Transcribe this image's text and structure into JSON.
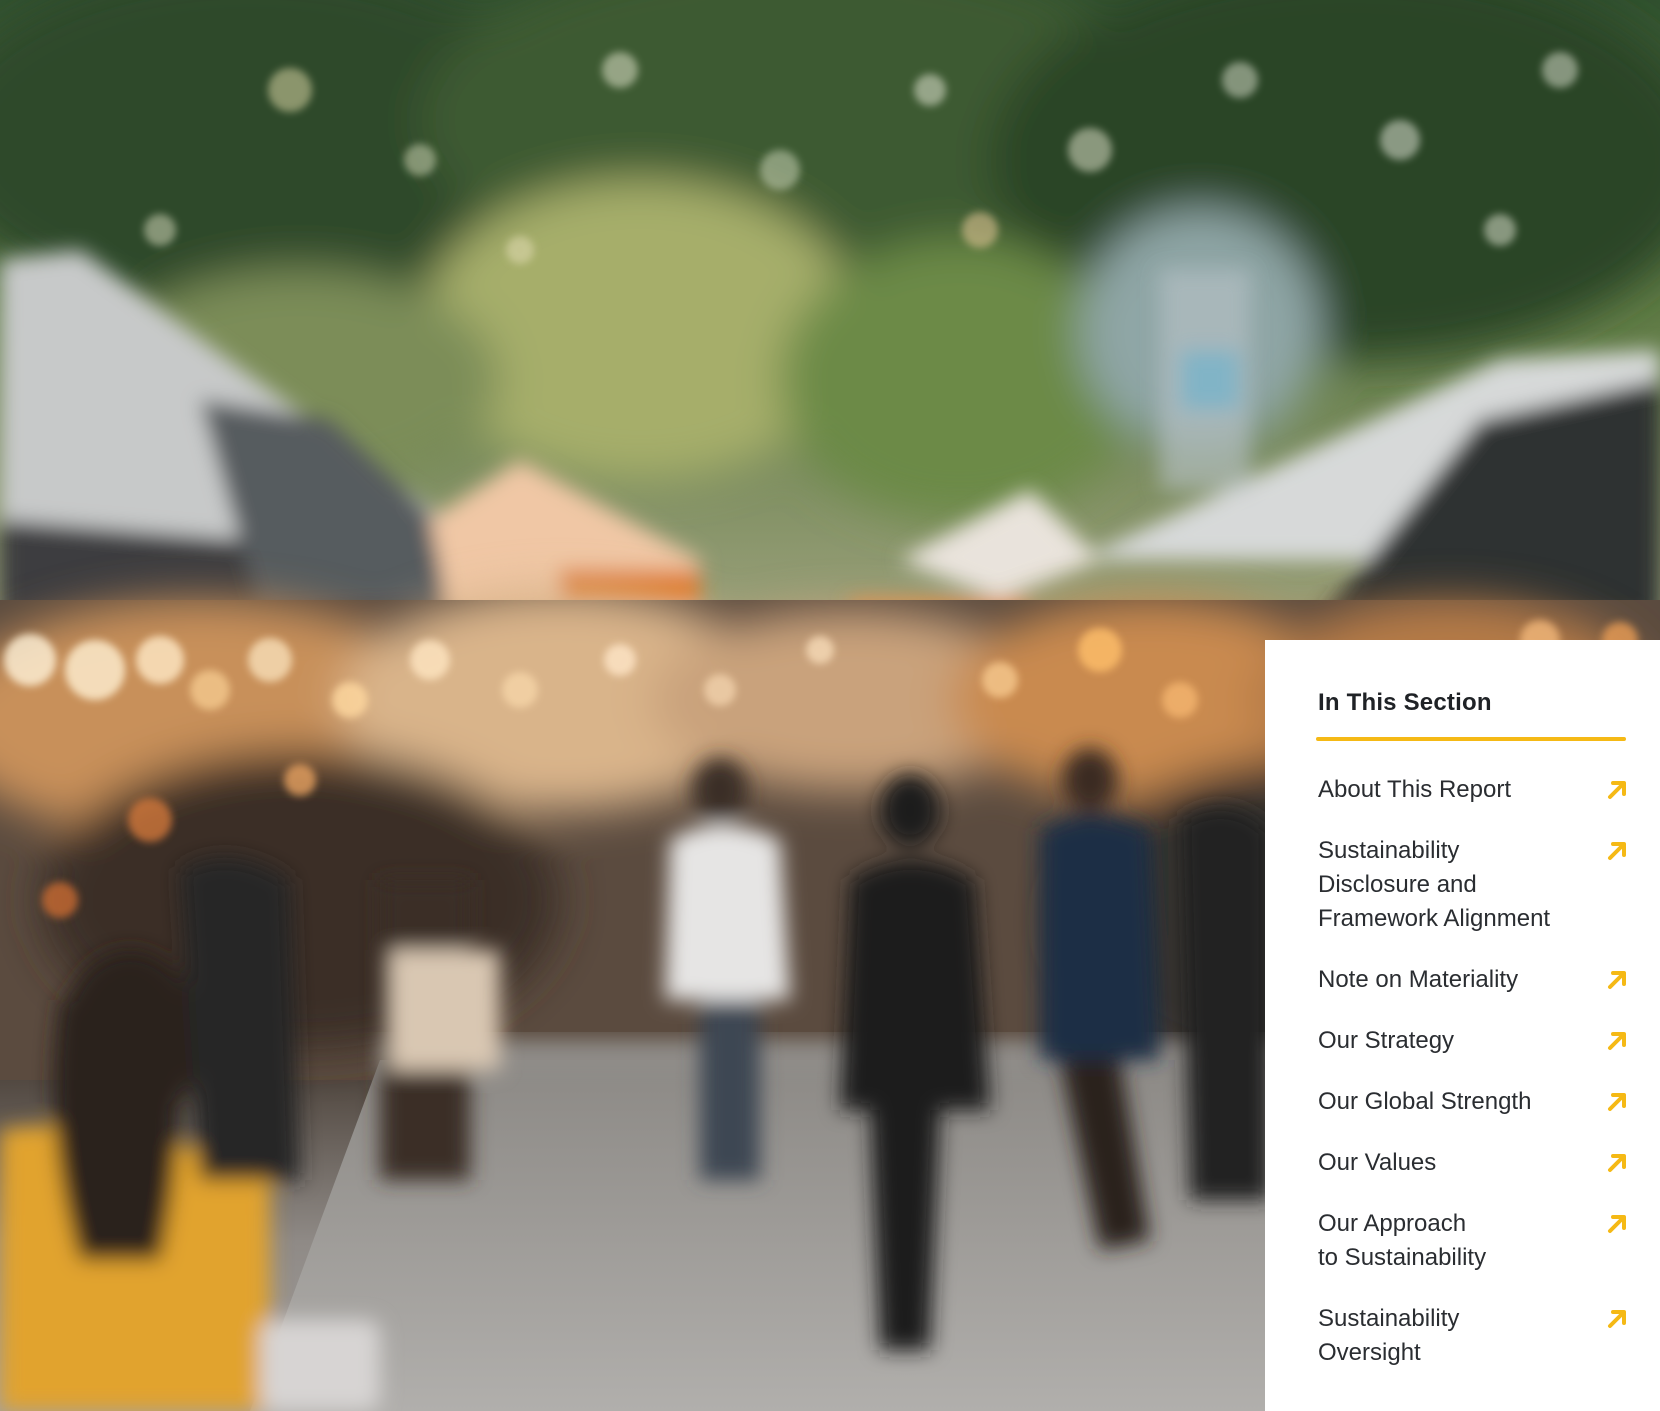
{
  "panel": {
    "title": "In This Section",
    "accent_color": "#f5b915",
    "arrow_icon": "arrow-up-right-icon",
    "items": [
      {
        "label": "About This Report"
      },
      {
        "label": "Sustainability\nDisclosure and\nFramework Alignment"
      },
      {
        "label": "Note on Materiality"
      },
      {
        "label": "Our Strategy"
      },
      {
        "label": "Our Global Strength"
      },
      {
        "label": "Our Values"
      },
      {
        "label": "Our Approach\nto Sustainability"
      },
      {
        "label": "Sustainability\nOversight"
      }
    ]
  },
  "background": {
    "subject": "blurred outdoor street market with tents, trees and people walking"
  }
}
